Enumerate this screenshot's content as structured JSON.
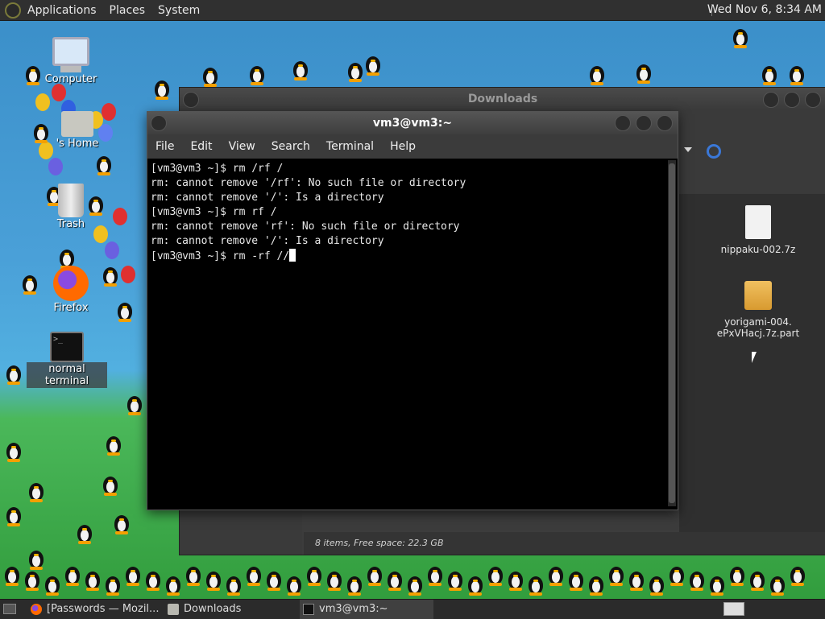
{
  "top_panel": {
    "menus": [
      "Applications",
      "Places",
      "System"
    ],
    "clock": "Wed Nov 6, 8:34 AM"
  },
  "desktop_icons": [
    {
      "label": "Computer",
      "icon": "computer-icon"
    },
    {
      "label": "'s Home",
      "icon": "home-folder-icon"
    },
    {
      "label": "Trash",
      "icon": "trash-icon"
    },
    {
      "label": "Firefox",
      "icon": "firefox-icon"
    },
    {
      "label": "normal terminal",
      "icon": "terminal-icon"
    }
  ],
  "downloads_window": {
    "title": "Downloads",
    "files": [
      {
        "name": "nippaku-002.7z",
        "icon": "file-icon"
      },
      {
        "name_line1": "yorigami-004.",
        "name_line2": "ePxVHacj.7z.part",
        "icon": "package-icon"
      }
    ],
    "status": "8 items, Free space: 22.3 GB"
  },
  "terminal_window": {
    "title": "vm3@vm3:~",
    "menus": [
      "File",
      "Edit",
      "View",
      "Search",
      "Terminal",
      "Help"
    ],
    "lines": [
      "[vm3@vm3 ~]$ rm /rf /",
      "rm: cannot remove '/rf': No such file or directory",
      "rm: cannot remove '/': Is a directory",
      "[vm3@vm3 ~]$ rm rf /",
      "rm: cannot remove 'rf': No such file or directory",
      "rm: cannot remove '/': Is a directory",
      "[vm3@vm3 ~]$ rm -rf //"
    ]
  },
  "taskbar": {
    "items": [
      {
        "label": "[Passwords — Mozil...",
        "icon": "firefox-icon"
      },
      {
        "label": "Downloads",
        "icon": "folder-icon"
      },
      {
        "label": "vm3@vm3:~",
        "icon": "terminal-icon"
      }
    ]
  }
}
